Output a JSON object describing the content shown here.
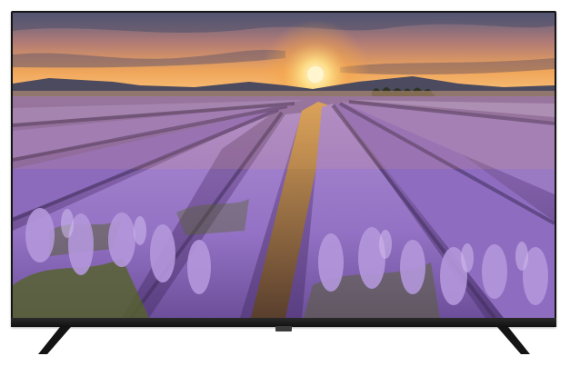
{
  "image": {
    "subject": "flat-screen-television",
    "scene": "lavender-field-sunset",
    "colors": {
      "bezel": "#161616",
      "sky_top": "#6b6f8a",
      "sky_glow": "#f6b05a",
      "sun": "#fff3c0",
      "lavender": "#9a76c8",
      "lavender_dark": "#5b3f80",
      "foliage": "#5f6b2a",
      "soil": "#6a4a3a"
    },
    "icons": [
      "tv-stand-foot-icon",
      "sun-icon"
    ]
  }
}
